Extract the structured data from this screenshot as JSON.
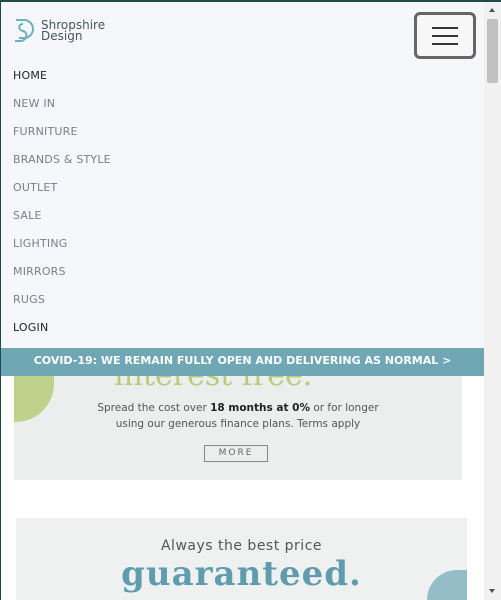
{
  "brand": {
    "name_line1": "Shropshire",
    "name_line2": "Design"
  },
  "nav": {
    "items": [
      {
        "label": "HOME",
        "active": true
      },
      {
        "label": "NEW IN"
      },
      {
        "label": "FURNITURE"
      },
      {
        "label": "BRANDS & STYLE"
      },
      {
        "label": "OUTLET"
      },
      {
        "label": "SALE"
      },
      {
        "label": "LIGHTING"
      },
      {
        "label": "MIRRORS"
      },
      {
        "label": "RUGS"
      },
      {
        "label": "LOGIN",
        "active": true
      }
    ]
  },
  "banner": {
    "text": "COVID-19: WE REMAIN FULLY OPEN AND DELIVERING AS NORMAL >"
  },
  "promo_finance": {
    "title": "interest free.",
    "line1_pre": "Spread the cost over ",
    "line1_bold": "18 months at 0%",
    "line1_post": " or for longer",
    "line2": "using our generous finance plans. Terms apply",
    "button": "MORE"
  },
  "promo_price": {
    "subtitle": "Always the best price",
    "title": "guaranteed."
  },
  "colors": {
    "banner": "#6fa7b5",
    "accent_green": "#b7cc7a",
    "accent_teal": "#5e9cae"
  },
  "icons": {
    "menu": "hamburger-icon",
    "logo": "logo-s-icon"
  }
}
